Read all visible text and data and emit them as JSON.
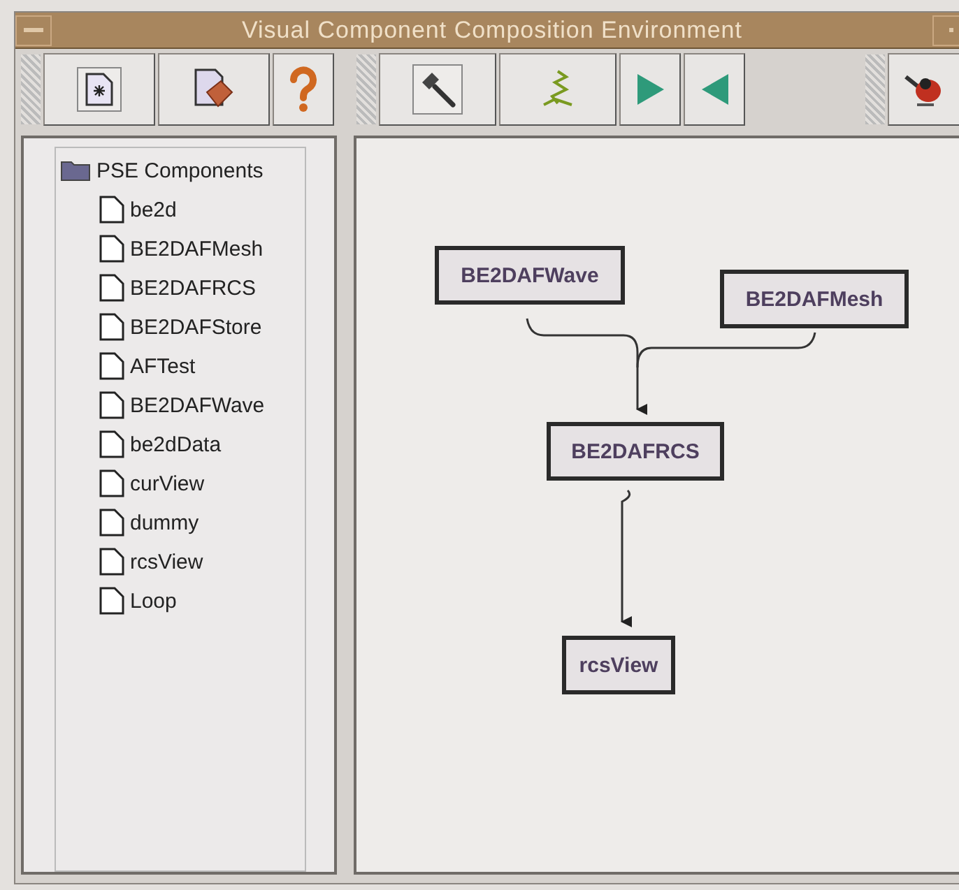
{
  "window": {
    "title": "Visual Component Composition Environment"
  },
  "tree": {
    "label": "PSE Components",
    "children": [
      {
        "label": "be2d"
      },
      {
        "label": "BE2DAFMesh"
      },
      {
        "label": "BE2DAFRCS"
      },
      {
        "label": "BE2DAFStore"
      },
      {
        "label": "AFTest"
      },
      {
        "label": "BE2DAFWave"
      },
      {
        "label": "be2dData"
      },
      {
        "label": "curView"
      },
      {
        "label": "dummy"
      },
      {
        "label": "rcsView"
      },
      {
        "label": "Loop"
      }
    ]
  },
  "canvas": {
    "nodes": [
      {
        "label": "BE2DAFWave"
      },
      {
        "label": "BE2DAFMesh"
      },
      {
        "label": "BE2DAFRCS"
      },
      {
        "label": "rcsView"
      }
    ]
  }
}
